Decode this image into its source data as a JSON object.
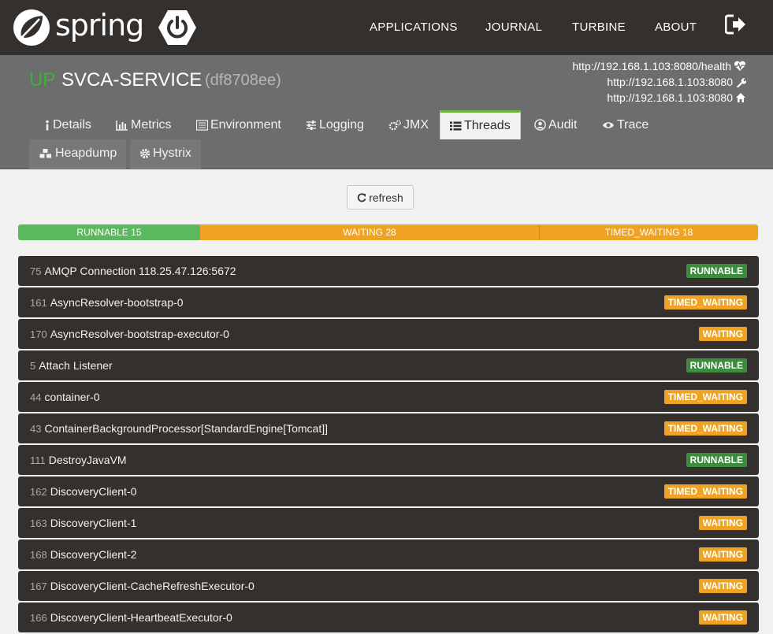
{
  "brand": {
    "logo_text": "spring"
  },
  "nav": {
    "applications": "APPLICATIONS",
    "journal": "JOURNAL",
    "turbine": "TURBINE",
    "about": "ABOUT"
  },
  "app": {
    "status": "UP",
    "name": "SVCA-SERVICE",
    "id": "(df8708ee)",
    "health_url": "http://192.168.1.103:8080/health",
    "management_url": "http://192.168.1.103:8080",
    "service_url": "http://192.168.1.103:8080"
  },
  "tabs": {
    "details": "Details",
    "metrics": "Metrics",
    "environment": "Environment",
    "logging": "Logging",
    "jmx": "JMX",
    "threads": "Threads",
    "audit": "Audit",
    "trace": "Trace",
    "heapdump": "Heapdump",
    "hystrix": "Hystrix"
  },
  "toolbar": {
    "refresh_label": "refresh"
  },
  "summary": {
    "runnable": {
      "label": "RUNNABLE 15",
      "count": 15
    },
    "waiting": {
      "label": "WAITING 28",
      "count": 28
    },
    "timed_waiting": {
      "label": "TIMED_WAITING 18",
      "count": 18
    }
  },
  "threads": [
    {
      "id": "75",
      "name": "AMQP Connection 118.25.47.126:5672",
      "state": "RUNNABLE"
    },
    {
      "id": "161",
      "name": "AsyncResolver-bootstrap-0",
      "state": "TIMED_WAITING"
    },
    {
      "id": "170",
      "name": "AsyncResolver-bootstrap-executor-0",
      "state": "WAITING"
    },
    {
      "id": "5",
      "name": "Attach Listener",
      "state": "RUNNABLE"
    },
    {
      "id": "44",
      "name": "container-0",
      "state": "TIMED_WAITING"
    },
    {
      "id": "43",
      "name": "ContainerBackgroundProcessor[StandardEngine[Tomcat]]",
      "state": "TIMED_WAITING"
    },
    {
      "id": "111",
      "name": "DestroyJavaVM",
      "state": "RUNNABLE"
    },
    {
      "id": "162",
      "name": "DiscoveryClient-0",
      "state": "TIMED_WAITING"
    },
    {
      "id": "163",
      "name": "DiscoveryClient-1",
      "state": "WAITING"
    },
    {
      "id": "168",
      "name": "DiscoveryClient-2",
      "state": "WAITING"
    },
    {
      "id": "167",
      "name": "DiscoveryClient-CacheRefreshExecutor-0",
      "state": "WAITING"
    },
    {
      "id": "166",
      "name": "DiscoveryClient-HeartbeatExecutor-0",
      "state": "WAITING"
    }
  ],
  "colors": {
    "navbar": "#34302d",
    "header": "#6d6d6d",
    "status_up": "#3bb33b",
    "runnable": "#3d8b3d",
    "waiting": "#f0a222",
    "accent": "#6db33f"
  }
}
